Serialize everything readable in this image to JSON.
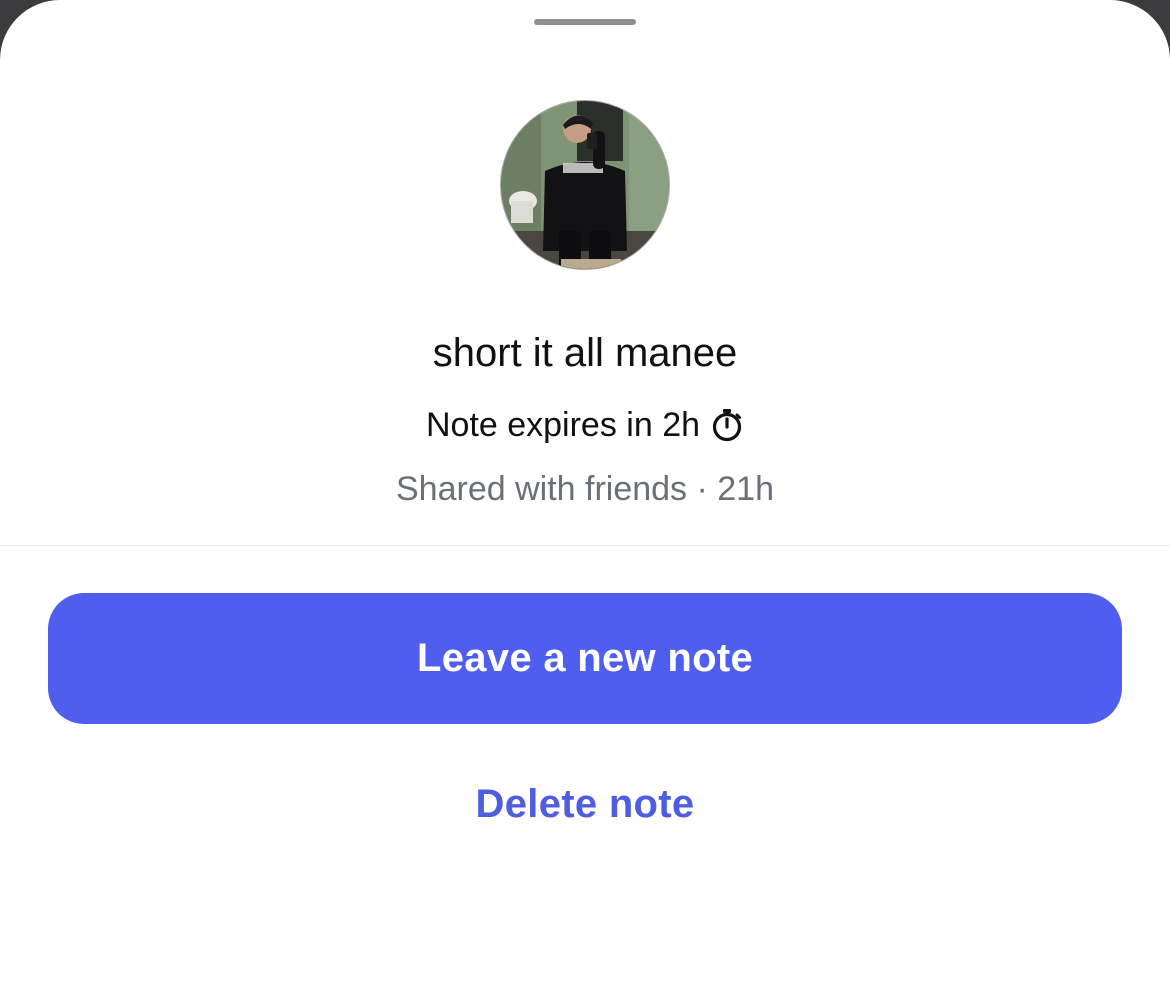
{
  "note": {
    "text": "short it all manee",
    "expiry_text": "Note expires in 2h",
    "expiry_icon": "stopwatch-icon",
    "meta_text": "Shared with friends · 21h"
  },
  "actions": {
    "primary_label": "Leave a new note",
    "secondary_label": "Delete note"
  },
  "colors": {
    "accent": "#4f5eef",
    "muted_text": "#6b6f78"
  }
}
